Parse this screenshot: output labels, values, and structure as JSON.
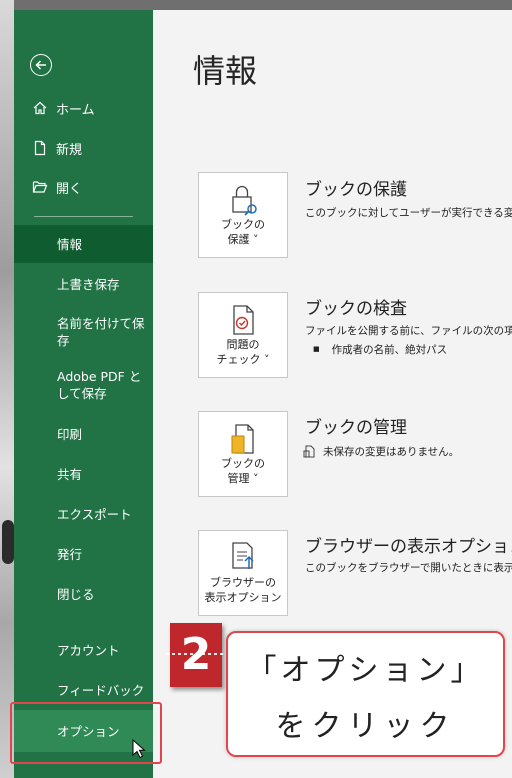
{
  "sidebar": {
    "top_items": [
      {
        "label": "ホーム",
        "icon": "home-icon"
      },
      {
        "label": "新規",
        "icon": "new-document-icon"
      },
      {
        "label": "開く",
        "icon": "open-folder-icon"
      }
    ],
    "items": [
      {
        "label": "情報"
      },
      {
        "label": "上書き保存"
      },
      {
        "label": "名前を付けて保存"
      },
      {
        "label": "Adobe PDF として保存"
      },
      {
        "label": "印刷"
      },
      {
        "label": "共有"
      },
      {
        "label": "エクスポート"
      },
      {
        "label": "発行"
      },
      {
        "label": "閉じる"
      },
      {
        "label": "アカウント"
      },
      {
        "label": "フィードバック"
      },
      {
        "label": "オプション"
      }
    ],
    "active_item": "情報",
    "hovered_item": "オプション",
    "color": "#217346"
  },
  "main": {
    "title": "情報",
    "sections": [
      {
        "button": "ブックの\n保護 ˅",
        "title": "ブックの保護",
        "desc": "このブックに対してユーザーが実行できる変更",
        "icon": "protect-workbook-icon"
      },
      {
        "button": "問題の\nチェック ˅",
        "title": "ブックの検査",
        "desc": "ファイルを公開する前に、ファイルの次の項目",
        "bullet": "作成者の名前、絶対パス",
        "icon": "inspect-workbook-icon"
      },
      {
        "button": "ブックの\n管理 ˅",
        "title": "ブックの管理",
        "desc": "未保存の変更はありません。",
        "icon": "manage-workbook-icon"
      },
      {
        "button": "ブラウザーの\n表示オプション",
        "title": "ブラウザーの表示オプション",
        "desc": "このブックをブラウザーで開いたときに表示され",
        "icon": "browser-view-icon"
      }
    ]
  },
  "callout": {
    "step": "2",
    "line1": "「オプション」",
    "line2": "をクリック",
    "color": "#c0272d"
  }
}
